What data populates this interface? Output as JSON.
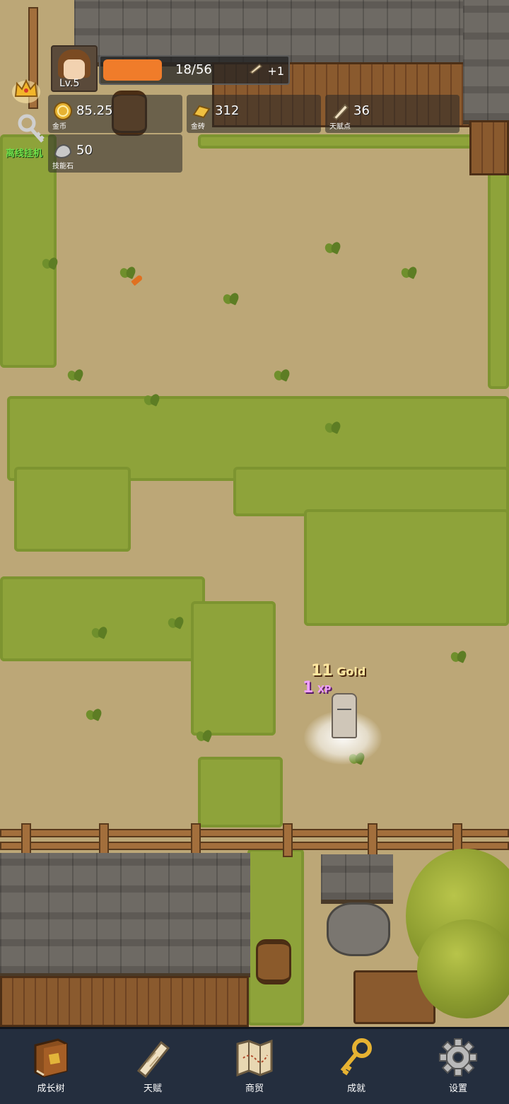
{
  "player": {
    "level_label": "Lv.5",
    "xp_text": "18/56",
    "xp_progress": 0.3214,
    "bonus_text": "+1",
    "xp_bar_color": "#f07c2a"
  },
  "resources": [
    {
      "id": "gold-coin",
      "value": "85.25",
      "label": "金币",
      "icon": "gold-coin-icon"
    },
    {
      "id": "gold-brick",
      "value": "312",
      "label": "金砖",
      "icon": "gold-bar-icon"
    },
    {
      "id": "talent-points",
      "value": "36",
      "label": "天赋点",
      "icon": "scroll-icon"
    },
    {
      "id": "skill-stone",
      "value": "50",
      "label": "技能石",
      "icon": "stone-icon"
    }
  ],
  "side": {
    "idle_label": "离线挂机"
  },
  "floating": {
    "gold_num": "11",
    "gold_text": "Gold",
    "xp_num": "1",
    "xp_text": "XP"
  },
  "nav": [
    {
      "label": "成长树",
      "icon": "book-icon"
    },
    {
      "label": "天赋",
      "icon": "scroll-icon"
    },
    {
      "label": "商贸",
      "icon": "map-icon"
    },
    {
      "label": "成就",
      "icon": "key-icon"
    },
    {
      "label": "设置",
      "icon": "gear-icon"
    }
  ]
}
